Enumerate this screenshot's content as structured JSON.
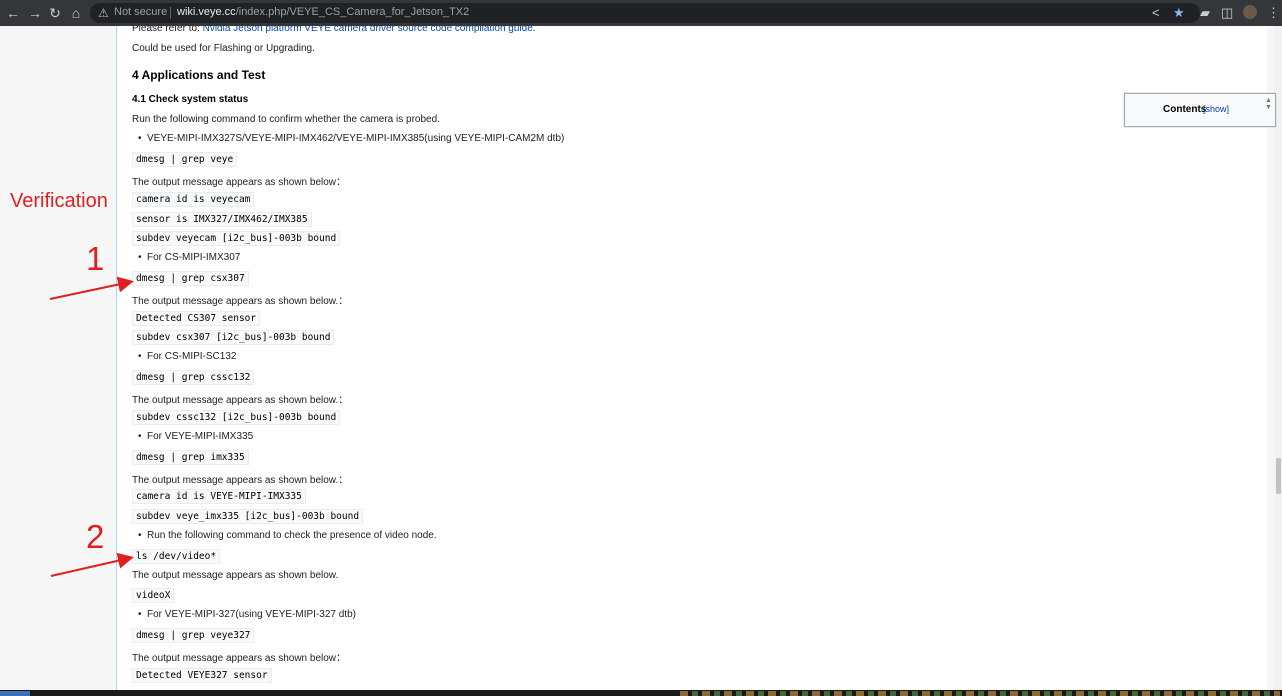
{
  "browser": {
    "security_label": "Not secure",
    "url_host": "wiki.veye.cc",
    "url_path": "/index.php/VEYE_CS_Camera_for_Jetson_TX2"
  },
  "article": {
    "refer_prefix": "Please refer to: ",
    "refer_link": "Nvidia Jetson platform VEYE camera driver source code compilation guide",
    "refer_suffix": ".",
    "flash_note": "Could be used for Flashing or Upgrading.",
    "heading_apps": "4 Applications and Test",
    "heading_status": "4.1 Check system status",
    "intro": "Run the following command to confirm whether the camera is probed.",
    "bullet_imx327": "VEYE-MIPI-IMX327S/VEYE-MIPI-IMX462/VEYE-MIPI-IMX385(using VEYE-MIPI-CAM2M dtb)",
    "cmd_veye": "dmesg | grep veye",
    "out_msg_colon": "The output message appears as shown below：",
    "out_veye_1": "camera id is veyecam",
    "out_veye_2": "sensor is IMX327/IMX462/IMX385",
    "out_veye_3": "subdev veyecam [i2c_bus]-003b bound",
    "bullet_imx307": "For CS-MIPI-IMX307",
    "cmd_csx307": "dmesg | grep csx307",
    "out_msg_dot_colon": "The output message appears as shown below.：",
    "out_csx307_1": "Detected CS307 sensor",
    "out_csx307_2": "subdev csx307 [i2c_bus]-003b bound",
    "bullet_sc132": "For CS-MIPI-SC132",
    "cmd_cssc132": "dmesg | grep cssc132",
    "out_cssc132_1": "subdev cssc132 [i2c_bus]-003b bound",
    "bullet_imx335": "For VEYE-MIPI-IMX335",
    "cmd_imx335": "dmesg | grep imx335",
    "out_imx335_1": "camera id is VEYE-MIPI-IMX335",
    "out_imx335_2": "subdev veye_imx335 [i2c_bus]-003b bound",
    "bullet_video": "Run the following command to check the presence of video node.",
    "cmd_video": "ls /dev/video*",
    "out_msg_dot": "The output message appears as shown below.",
    "out_video": "videoX",
    "bullet_327": "For VEYE-MIPI-327(using VEYE-MIPI-327 dtb)",
    "cmd_veye327": "dmesg | grep veye327",
    "out_veye327": "Detected VEYE327 sensor"
  },
  "toc": {
    "title": "Contents",
    "show": "[show]"
  },
  "annotations": {
    "verification": "Verification",
    "step1": "1",
    "step2": "2",
    "color": "#e02020"
  }
}
